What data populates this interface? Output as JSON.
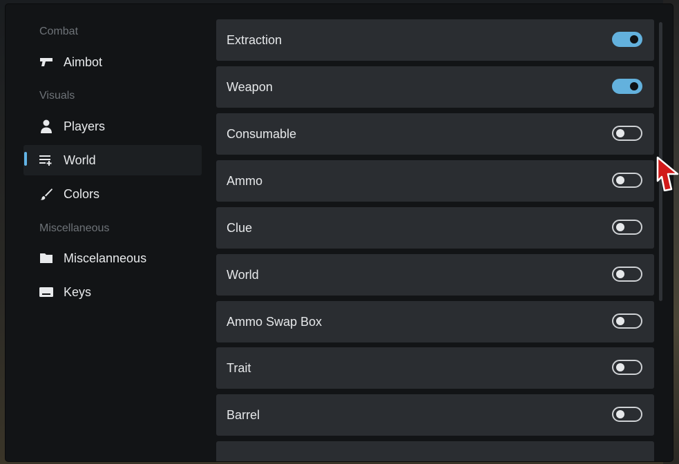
{
  "sidebar": {
    "sections": [
      {
        "title": "Combat",
        "items": [
          {
            "label": "Aimbot",
            "icon": "gun-icon"
          }
        ]
      },
      {
        "title": "Visuals",
        "items": [
          {
            "label": "Players",
            "icon": "person-icon"
          },
          {
            "label": "World",
            "icon": "list-icon",
            "active": true
          },
          {
            "label": "Colors",
            "icon": "brush-icon"
          }
        ]
      },
      {
        "title": "Miscellaneous",
        "items": [
          {
            "label": "Miscelanneous",
            "icon": "folder-icon"
          },
          {
            "label": "Keys",
            "icon": "keyboard-icon"
          }
        ]
      }
    ]
  },
  "options": [
    {
      "label": "Extraction",
      "enabled": true
    },
    {
      "label": "Weapon",
      "enabled": true
    },
    {
      "label": "Consumable",
      "enabled": false
    },
    {
      "label": "Ammo",
      "enabled": false
    },
    {
      "label": "Clue",
      "enabled": false
    },
    {
      "label": "World",
      "enabled": false
    },
    {
      "label": "Ammo Swap Box",
      "enabled": false
    },
    {
      "label": "Trait",
      "enabled": false
    },
    {
      "label": "Barrel",
      "enabled": false
    }
  ],
  "colors": {
    "accent": "#63b1dd",
    "active_bar": "#62b4e6",
    "row_bg": "#2a2d31",
    "window_bg": "#121416"
  }
}
